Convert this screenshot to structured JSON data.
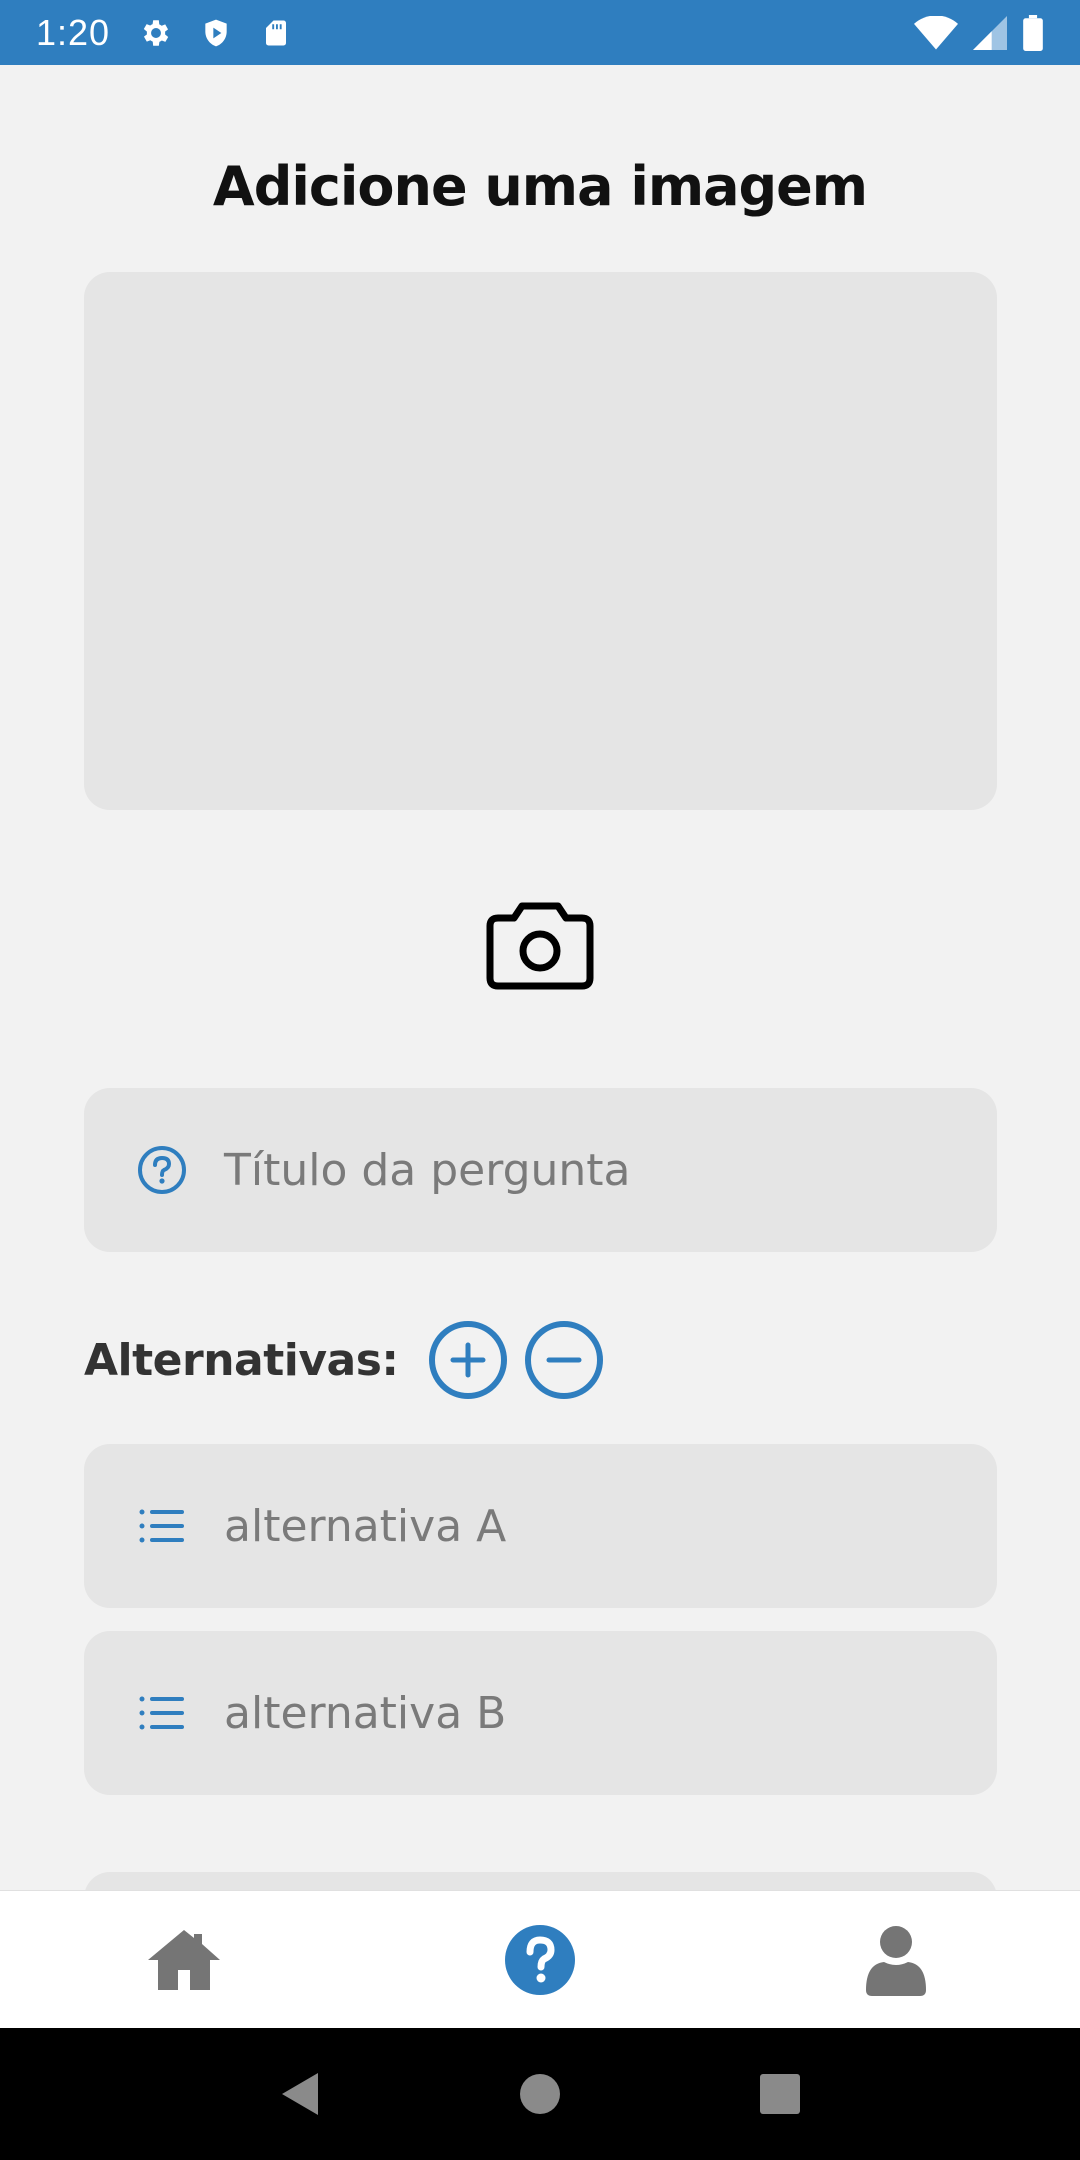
{
  "status_bar": {
    "time": "1:20",
    "left_icons": [
      "gear-icon",
      "shield-icon",
      "sd-card-icon"
    ],
    "right_icons": [
      "wifi-icon",
      "signal-icon",
      "battery-icon"
    ],
    "background": "#2f7ebf"
  },
  "page": {
    "title": "Adicione uma imagem"
  },
  "question": {
    "placeholder": "Título da pergunta",
    "icon": "help-circle-icon"
  },
  "alternatives": {
    "label": "Alternativas:",
    "add_icon": "plus-circle-icon",
    "remove_icon": "minus-circle-icon",
    "items": [
      {
        "label": "alternativa A",
        "icon": "list-icon"
      },
      {
        "label": "alternativa B",
        "icon": "list-icon"
      }
    ]
  },
  "bottom_nav": {
    "items": [
      {
        "icon": "home-icon",
        "active": false
      },
      {
        "icon": "question-icon",
        "active": true
      },
      {
        "icon": "user-icon",
        "active": false
      }
    ],
    "active_color": "#2f7ebf",
    "inactive_color": "#757575"
  },
  "colors": {
    "accent": "#2f7ebf",
    "background": "#f2f2f2",
    "field_background": "#e5e5e5"
  }
}
